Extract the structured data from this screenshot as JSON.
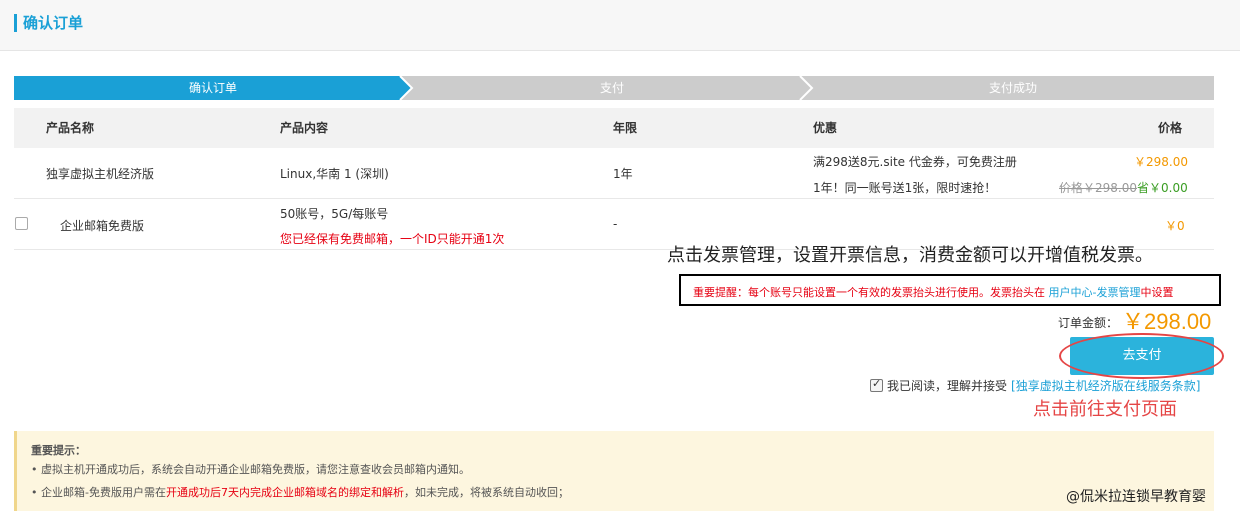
{
  "header": {
    "title": "确认订单"
  },
  "steps": [
    {
      "label": "确认订单",
      "active": true
    },
    {
      "label": "支付",
      "active": false
    },
    {
      "label": "支付成功",
      "active": false
    }
  ],
  "table": {
    "columns": [
      "产品名称",
      "产品内容",
      "年限",
      "优惠",
      "价格"
    ],
    "rows": [
      {
        "name": "独享虚拟主机经济版",
        "content": "Linux,华南 1 (深圳)",
        "period": "1年",
        "promo1": "满298送8元.site 代金券，可免费注册",
        "promo2": "1年！同一账号送1张，限时速抢！",
        "price": "￥298.00",
        "original_price": "价格￥298.00",
        "saved": "省￥0.00"
      },
      {
        "name": "企业邮箱免费版",
        "content": "50账号，5G/每账号",
        "note": "您已经保有免费邮箱，一个ID只能开通1次",
        "period": "-",
        "price": "￥0",
        "checked": false
      }
    ]
  },
  "annotation_invoice": "点击发票管理，设置开票信息，消费金额可以开增值税发票。",
  "reminder": {
    "prefix": "重要提醒：每个账号只能设置一个有效的发票抬头进行使用。发票抬头在 ",
    "link": "用户中心-发票管理",
    "suffix": "中设置"
  },
  "order_total": {
    "label": "订单金额：",
    "value": "￥298.00"
  },
  "pay_button": "去支付",
  "agreement": {
    "text": "我已阅读，理解并接受",
    "link": "[独享虚拟主机经济版在线服务条款]",
    "checked": true
  },
  "annotation_pay": "点击前往支付页面",
  "notice": {
    "title": "重要提示：",
    "line1": "• 虚拟主机开通成功后，系统会自动开通企业邮箱免费版，请您注意查收会员邮箱内通知。",
    "line2_a": "• 企业邮箱-免费版用户需在",
    "line2_b": "开通成功后7天内完成企业邮箱域名的绑定和解析",
    "line2_c": "，如未完成，将被系统自动收回；"
  },
  "watermark": "@侃米拉连锁早教育婴",
  "colors": {
    "accent": "#1aa0d6",
    "step_inactive": "#cccccc",
    "price": "#f39800",
    "pay_button": "#2bb3dc",
    "annotation_red": "#e54545"
  }
}
